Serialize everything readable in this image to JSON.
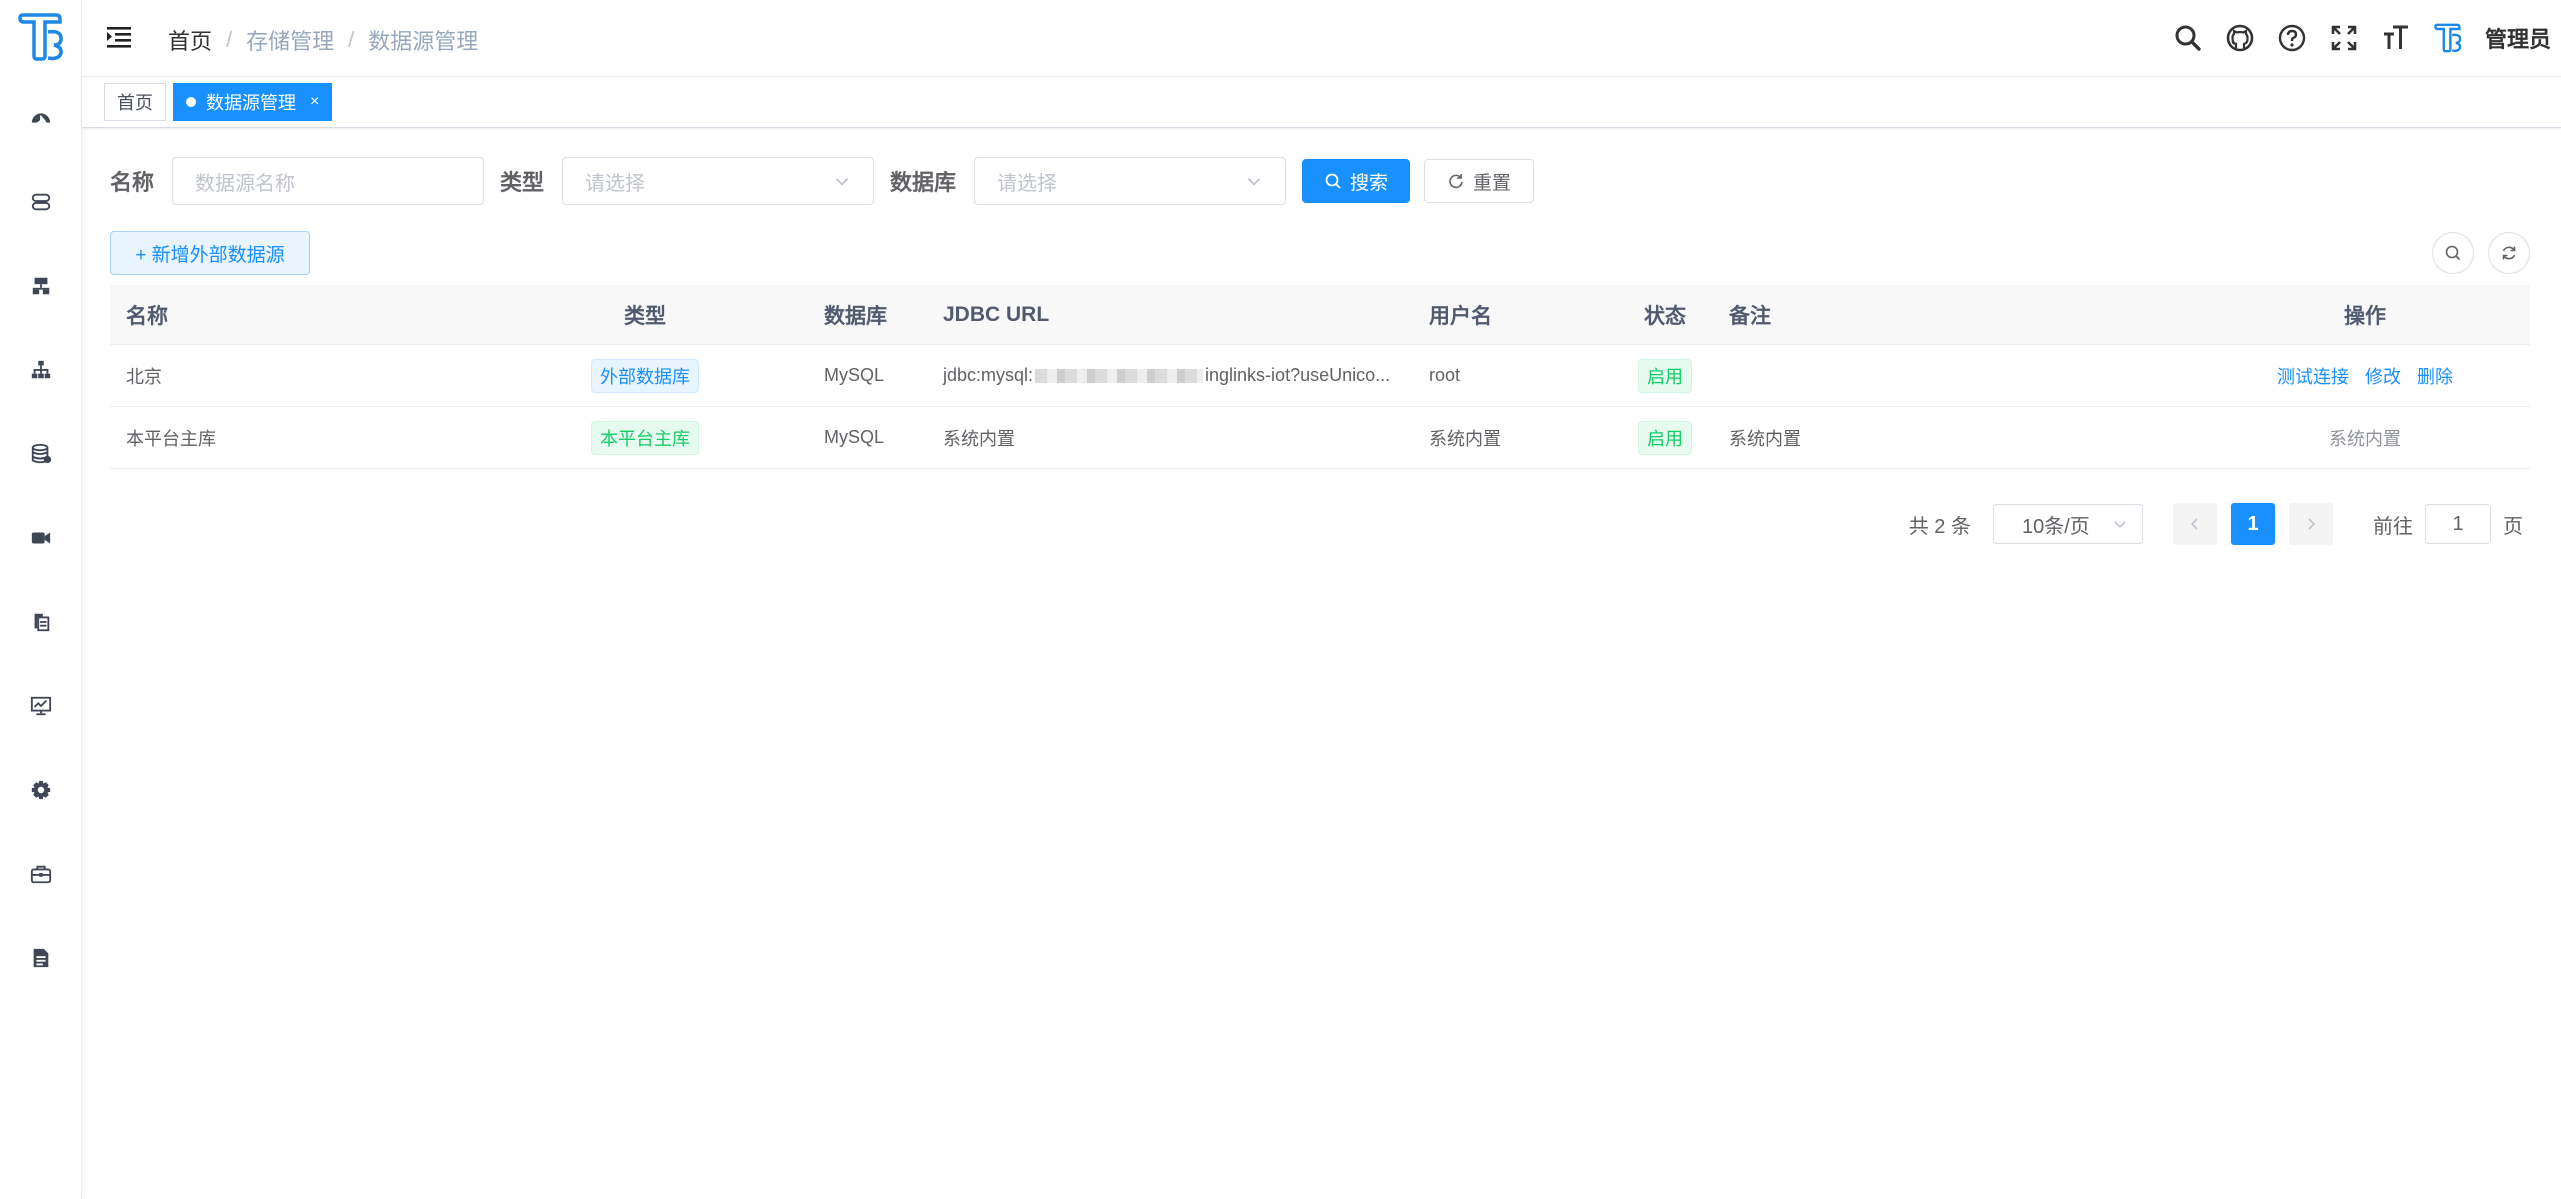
{
  "sidebar": {
    "items": [
      {
        "icon": "dashboard-icon"
      },
      {
        "icon": "server-icon"
      },
      {
        "icon": "network-icon"
      },
      {
        "icon": "org-tree-icon"
      },
      {
        "icon": "database-icon"
      },
      {
        "icon": "video-camera-icon"
      },
      {
        "icon": "copy-files-icon"
      },
      {
        "icon": "monitor-icon"
      },
      {
        "icon": "settings-gear-icon"
      },
      {
        "icon": "toolbox-icon"
      },
      {
        "icon": "document-icon"
      }
    ]
  },
  "header": {
    "breadcrumb": [
      "首页",
      "存储管理",
      "数据源管理"
    ],
    "breadcrumb_sep": "/",
    "user_name": "管理员"
  },
  "tags": {
    "home": "首页",
    "active": "数据源管理",
    "close": "×"
  },
  "search": {
    "name_label": "名称",
    "name_placeholder": "数据源名称",
    "type_label": "类型",
    "type_placeholder": "请选择",
    "db_label": "数据库",
    "db_placeholder": "请选择",
    "search_button": "搜索",
    "reset_button": "重置"
  },
  "toolbar": {
    "add_button": "+ 新增外部数据源"
  },
  "table": {
    "columns": [
      "名称",
      "类型",
      "数据库",
      "JDBC URL",
      "用户名",
      "状态",
      "备注",
      "操作"
    ],
    "rows": [
      {
        "name": "北京",
        "type": "外部数据库",
        "db": "MySQL",
        "jdbc_prefix": "jdbc:mysql:",
        "jdbc_suffix": "inglinks-iot?useUnico...",
        "user": "root",
        "status": "启用",
        "remark": "",
        "actions": [
          "测试连接",
          "修改",
          "删除"
        ]
      },
      {
        "name": "本平台主库",
        "type": "本平台主库",
        "db": "MySQL",
        "jdbc": "系统内置",
        "user": "系统内置",
        "status": "启用",
        "remark": "系统内置",
        "action_text": "系统内置"
      }
    ]
  },
  "pagination": {
    "total": "共 2 条",
    "page_size": "10条/页",
    "current_page": "1",
    "goto_label": "前往",
    "goto_value": "1",
    "page_suffix": "页"
  },
  "colors": {
    "primary": "#1890ff",
    "success": "#13ce66"
  }
}
